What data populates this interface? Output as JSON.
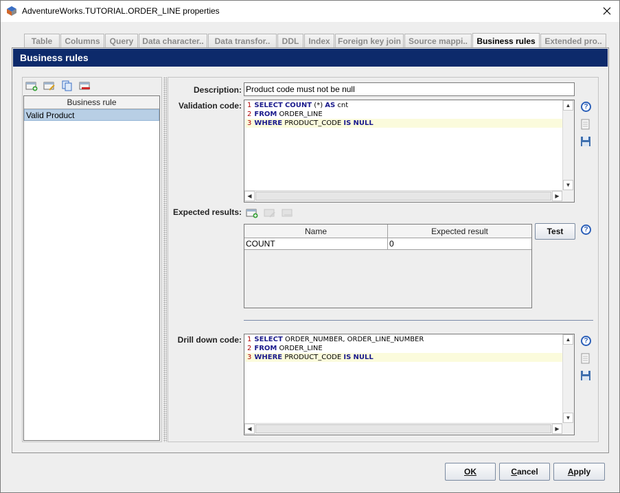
{
  "window": {
    "title": "AdventureWorks.TUTORIAL.ORDER_LINE properties"
  },
  "tabs": [
    {
      "label": "Table"
    },
    {
      "label": "Columns"
    },
    {
      "label": "Query"
    },
    {
      "label": "Data character.."
    },
    {
      "label": "Data transfor.."
    },
    {
      "label": "DDL"
    },
    {
      "label": "Index"
    },
    {
      "label": "Foreign key join"
    },
    {
      "label": "Source mappi.."
    },
    {
      "label": "Business rules"
    },
    {
      "label": "Extended pro.."
    }
  ],
  "active_tab": "Business rules",
  "section": {
    "title": "Business rules"
  },
  "rules_list": {
    "header": "Business rule",
    "items": [
      {
        "label": "Valid Product",
        "selected": true
      }
    ]
  },
  "form": {
    "description_label": "Description:",
    "description_value": "Product code must not be null",
    "validation_label": "Validation code:",
    "validation_lines": [
      {
        "num": "1",
        "kw1": "SELECT",
        "t1": " ",
        "kw2": "COUNT",
        "t2": " (*) ",
        "kw3": "AS",
        "t3": " cnt"
      },
      {
        "num": "2",
        "kw1": "FROM",
        "t1": " ORDER_LINE",
        "kw2": "",
        "t2": "",
        "kw3": "",
        "t3": ""
      },
      {
        "num": "3",
        "kw1": "WHERE",
        "t1": " PRODUCT_CODE ",
        "kw2": "IS",
        "t2": " ",
        "kw3": "NULL",
        "t3": ""
      }
    ],
    "expected_results_label": "Expected results:",
    "results_columns": [
      "Name",
      "Expected result"
    ],
    "results_rows": [
      {
        "name": "COUNT",
        "expected": "0"
      }
    ],
    "test_button": "Test",
    "drilldown_label": "Drill down code:",
    "drilldown_lines": [
      {
        "num": "1",
        "kw1": "SELECT",
        "t1": " ORDER_NUMBER, ORDER_LINE_NUMBER",
        "kw2": "",
        "t2": "",
        "kw3": "",
        "t3": ""
      },
      {
        "num": "2",
        "kw1": "FROM",
        "t1": " ORDER_LINE",
        "kw2": "",
        "t2": "",
        "kw3": "",
        "t3": ""
      },
      {
        "num": "3",
        "kw1": "WHERE",
        "t1": " PRODUCT_CODE ",
        "kw2": "IS",
        "t2": " ",
        "kw3": "NULL",
        "t3": ""
      }
    ]
  },
  "footer": {
    "ok": "OK",
    "cancel_u": "C",
    "cancel_rest": "ancel",
    "apply_u": "A",
    "apply_rest": "pply"
  },
  "colors": {
    "header_bg": "#0d2a6b",
    "selection": "#b8cfe5",
    "keyword": "#1a1a8c",
    "line_number": "#b00000",
    "highlight_line": "#fbfbdc"
  }
}
